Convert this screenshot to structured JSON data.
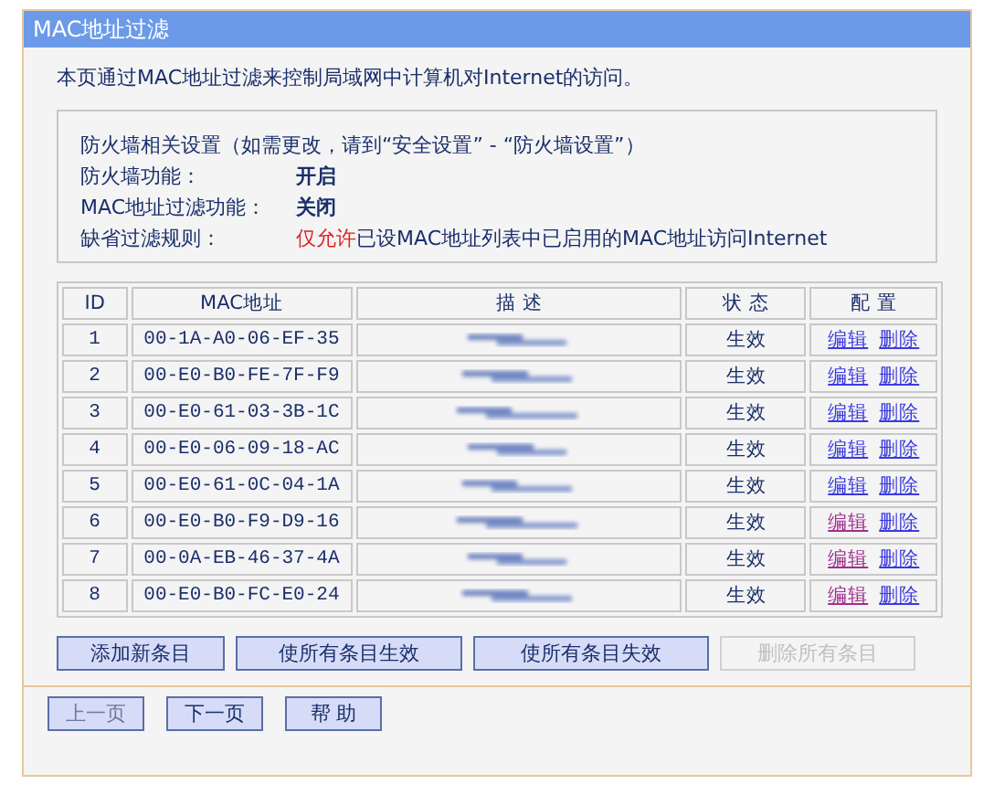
{
  "window": {
    "title": "MAC地址过滤"
  },
  "intro": "本页通过MAC地址过滤来控制局域网中计算机对Internet的访问。",
  "firewall": {
    "heading": "防火墙相关设置（如需更改，请到“安全设置” - “防火墙设置”）",
    "rows": [
      {
        "label": "防火墙功能：",
        "value": "开启",
        "kind": "bold"
      },
      {
        "label": "MAC地址过滤功能：",
        "value": "关闭",
        "kind": "bold"
      },
      {
        "label": "缺省过滤规则：",
        "value": "**仅允许**已设MAC地址列表中已启用的MAC地址访问Internet",
        "kind": "rule"
      }
    ]
  },
  "table": {
    "columns": [
      "ID",
      "MAC地址",
      "描 述",
      "状 态",
      "配 置"
    ],
    "rows": [
      {
        "id": "1",
        "mac": "00-1A-A0-06-EF-35",
        "status": "生效",
        "edit": "编辑",
        "delete": "删除",
        "edit_visited": false
      },
      {
        "id": "2",
        "mac": "00-E0-B0-FE-7F-F9",
        "status": "生效",
        "edit": "编辑",
        "delete": "删除",
        "edit_visited": false
      },
      {
        "id": "3",
        "mac": "00-E0-61-03-3B-1C",
        "status": "生效",
        "edit": "编辑",
        "delete": "删除",
        "edit_visited": false
      },
      {
        "id": "4",
        "mac": "00-E0-06-09-18-AC",
        "status": "生效",
        "edit": "编辑",
        "delete": "删除",
        "edit_visited": false
      },
      {
        "id": "5",
        "mac": "00-E0-61-0C-04-1A",
        "status": "生效",
        "edit": "编辑",
        "delete": "删除",
        "edit_visited": false
      },
      {
        "id": "6",
        "mac": "00-E0-B0-F9-D9-16",
        "status": "生效",
        "edit": "编辑",
        "delete": "删除",
        "edit_visited": true
      },
      {
        "id": "7",
        "mac": "00-0A-EB-46-37-4A",
        "status": "生效",
        "edit": "编辑",
        "delete": "删除",
        "edit_visited": true
      },
      {
        "id": "8",
        "mac": "00-E0-B0-FC-E0-24",
        "status": "生效",
        "edit": "编辑",
        "delete": "删除",
        "edit_visited": true
      }
    ]
  },
  "actions": [
    {
      "label": "添加新条目",
      "disabled": false
    },
    {
      "label": "使所有条目生效",
      "disabled": false
    },
    {
      "label": "使所有条目失效",
      "disabled": false
    },
    {
      "label": "删除所有条目",
      "disabled": true
    }
  ],
  "footer": [
    {
      "label": "上一页",
      "disabled": true
    },
    {
      "label": "下一页",
      "disabled": false
    },
    {
      "label": "帮 助",
      "disabled": false
    }
  ]
}
